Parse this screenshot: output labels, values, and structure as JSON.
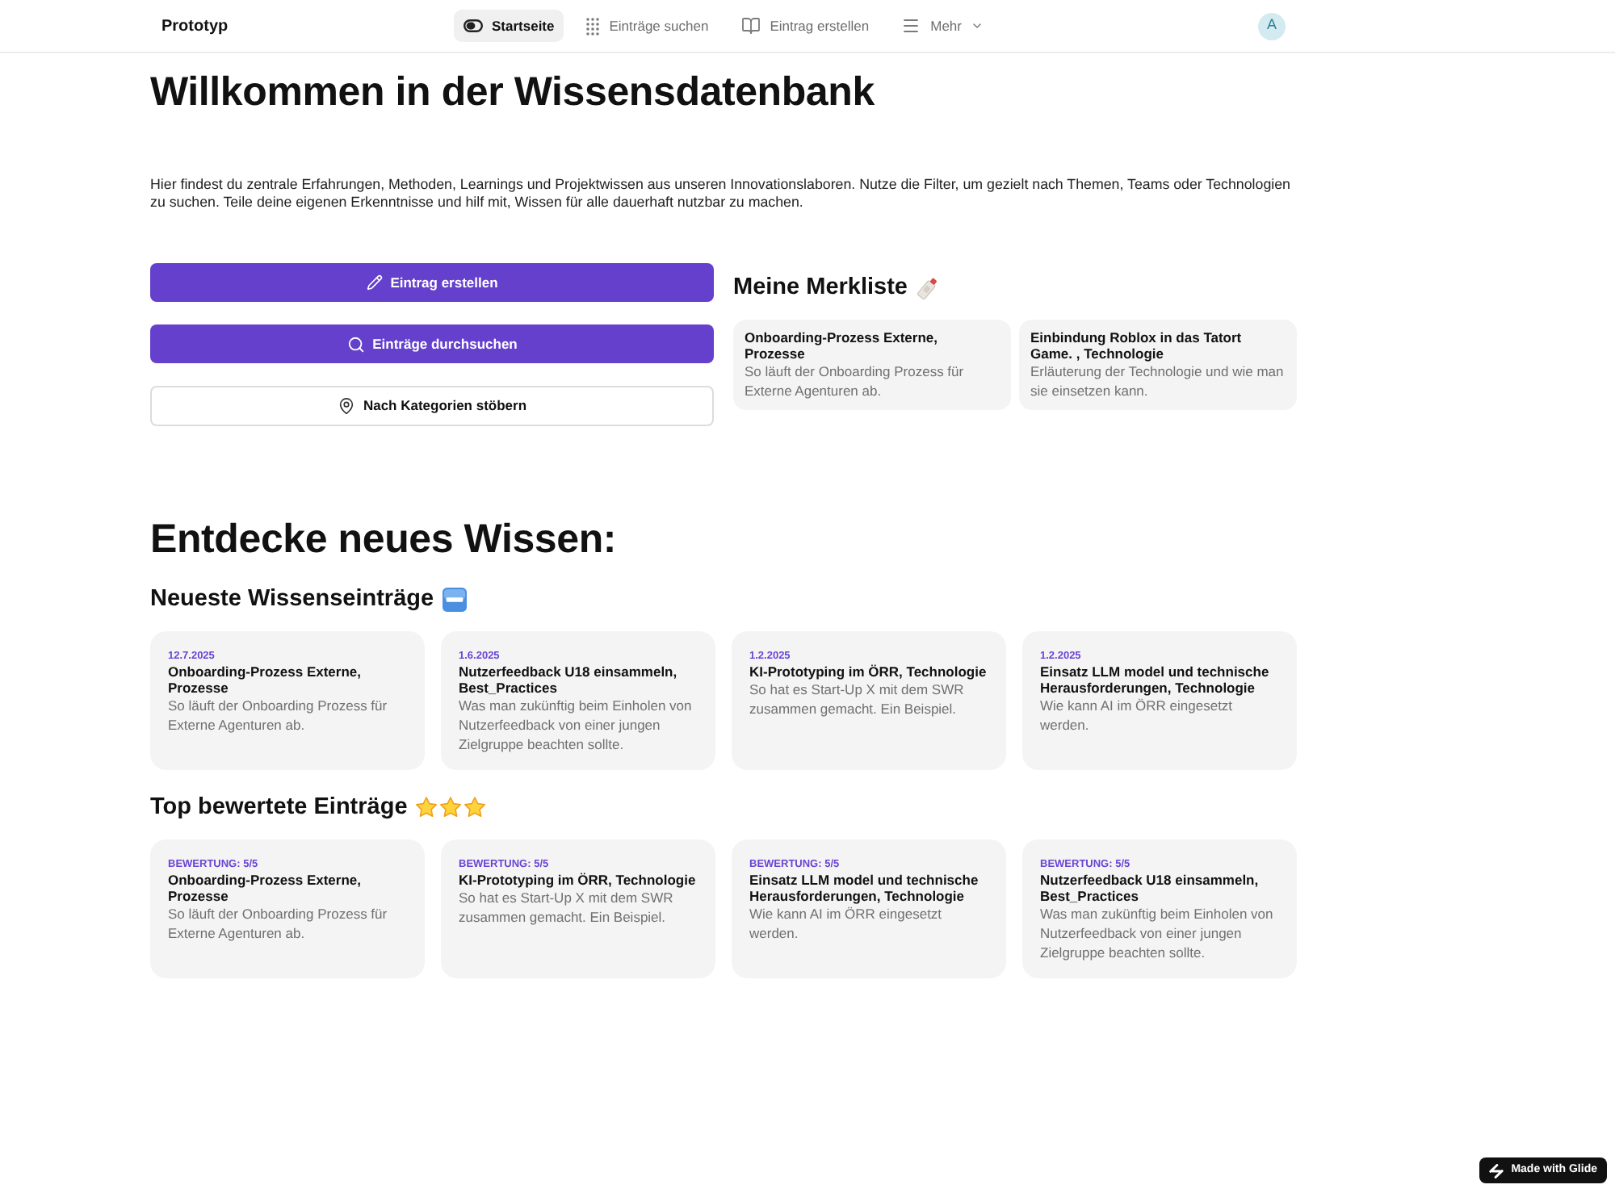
{
  "nav": {
    "brand": "Prototyp",
    "tabs": [
      {
        "label": "Startseite",
        "selected": true,
        "kind": "link"
      },
      {
        "label": "Einträge suchen",
        "selected": false,
        "kind": "link"
      },
      {
        "label": "Eintrag erstellen",
        "selected": false,
        "kind": "link"
      },
      {
        "label": "Mehr",
        "selected": false,
        "kind": "dropdown"
      }
    ],
    "avatar": "A"
  },
  "hero": {
    "title": "Willkommen in der Wissensdatenbank",
    "intro": "Hier findest du zentrale Erfahrungen, Methoden, Learnings und Projektwissen aus unseren Innovationslaboren. Nutze die Filter, um gezielt nach Themen, Teams oder Technologien zu suchen. Teile deine eigenen Erkenntnisse und hilf mit, Wissen für alle dauerhaft nutzbar zu machen."
  },
  "actions": [
    {
      "label": "Eintrag erstellen",
      "kind": "primary"
    },
    {
      "label": "Einträge durchsuchen",
      "kind": "primary"
    },
    {
      "label": "Nach Kategorien stöbern",
      "kind": "secondary"
    }
  ],
  "watchlist": {
    "title": "Meine Merkliste",
    "items": [
      {
        "title": "Onboarding-Prozess Externe, Prozesse",
        "description": "So läuft der Onboarding Prozess für Externe Agenturen ab."
      },
      {
        "title": "Einbindung Roblox in das Tatort Game. , Technologie",
        "description": "Erläuterung der Technologie und wie man sie einsetzen kann."
      }
    ]
  },
  "discover": {
    "title": "Entdecke neues Wissen:"
  },
  "latest": {
    "title": "Neueste Wissenseinträge",
    "items": [
      {
        "date": "12.7.2025",
        "title": "Onboarding-Prozess Externe, Prozesse",
        "description": "So läuft der Onboarding Prozess für Externe Agenturen ab."
      },
      {
        "date": "1.6.2025",
        "title": "Nutzerfeedback U18 einsammeln, Best_Practices",
        "description": "Was man zukünftig beim Einholen von Nutzerfeedback von einer jungen Zielgruppe beachten sollte."
      },
      {
        "date": "1.2.2025",
        "title": "KI-Prototyping im ÖRR, Technologie",
        "description": "So hat es Start-Up X mit dem SWR zusammen gemacht. Ein Beispiel."
      },
      {
        "date": "1.2.2025",
        "title": "Einsatz LLM model und technische Herausforderungen, Technologie",
        "description": "Wie kann AI im ÖRR eingesetzt werden."
      }
    ]
  },
  "top_rated": {
    "title": "Top bewertete Einträge",
    "items": [
      {
        "rating": "BEWERTUNG: 5/5",
        "title": "Onboarding-Prozess Externe, Prozesse",
        "description": "So läuft der Onboarding Prozess für Externe Agenturen ab."
      },
      {
        "rating": "BEWERTUNG: 5/5",
        "title": "KI-Prototyping im ÖRR, Technologie",
        "description": "So hat es Start-Up X mit dem SWR zusammen gemacht. Ein Beispiel."
      },
      {
        "rating": "BEWERTUNG: 5/5",
        "title": "Einsatz LLM model und technische Herausforderungen, Technologie",
        "description": "Wie kann AI im ÖRR eingesetzt werden."
      },
      {
        "rating": "BEWERTUNG: 5/5",
        "title": "Nutzerfeedback U18 einsammeln, Best_Practices",
        "description": "Was man zukünftig beim Einholen von Nutzerfeedback von einer jungen Zielgruppe beachten sollte."
      }
    ]
  },
  "badge": "Made with Glide"
}
